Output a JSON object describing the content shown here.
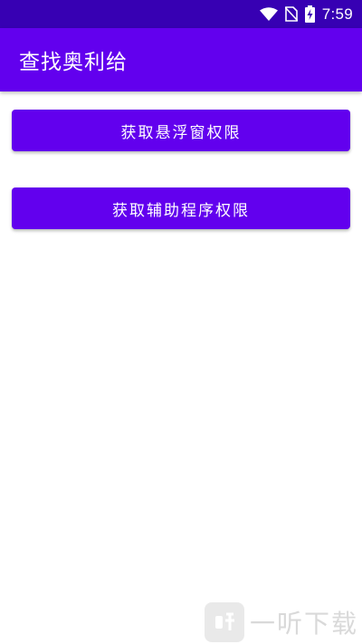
{
  "status_bar": {
    "time": "7:59",
    "icons": [
      "wifi-icon",
      "no-sim-icon",
      "battery-charging-icon"
    ]
  },
  "app_bar": {
    "title": "查找奥利给"
  },
  "buttons": {
    "overlay_permission": "获取悬浮窗权限",
    "accessibility_permission": "获取辅助程序权限"
  },
  "watermark": {
    "text": "一听下载"
  },
  "colors": {
    "status_bar": "#3700b3",
    "primary": "#6200ee",
    "background": "#ffffff",
    "on_primary": "#ffffff"
  }
}
